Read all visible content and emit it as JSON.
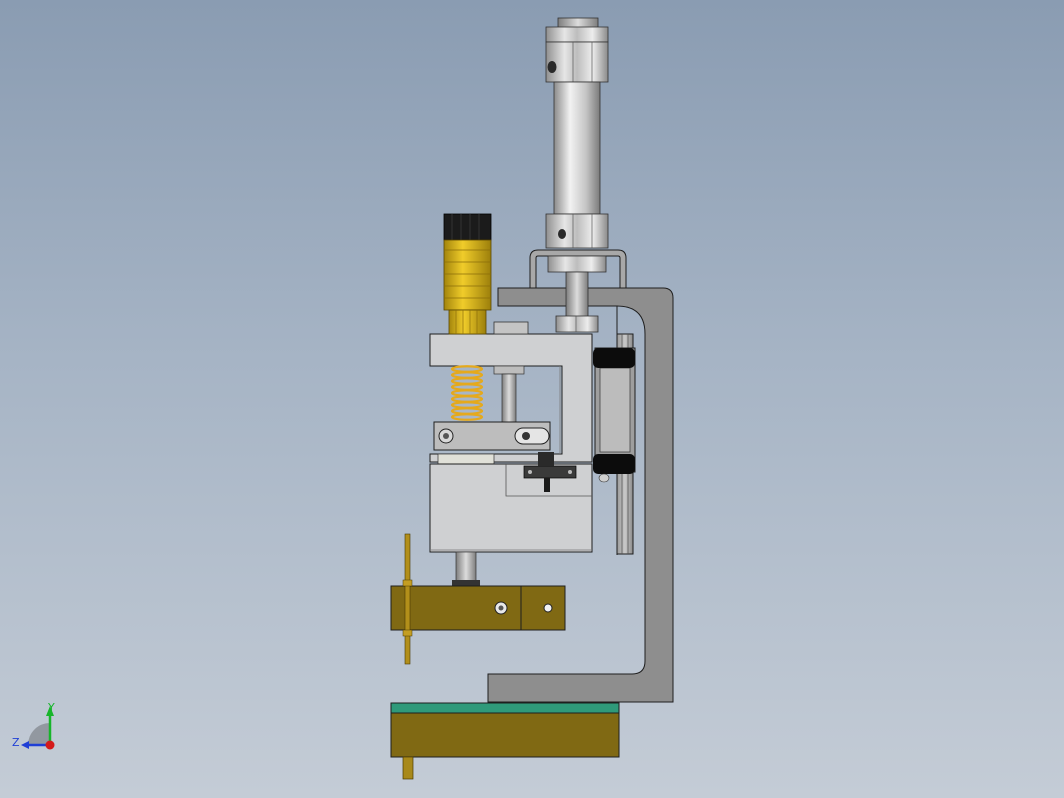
{
  "view": {
    "background_top": "#8a9cb2",
    "background_bottom": "#c4ccd6"
  },
  "model": {
    "colors": {
      "frame": "#8e8e8e",
      "block": "#cfd0d2",
      "gold": "#806913",
      "knob_gold": "#d0ad18",
      "spring": "#e5a91c",
      "rail_black": "#0c0c0c",
      "base_green": "#2f9a7a",
      "outline": "#1e1e1e"
    }
  },
  "triad": {
    "y_label": "Y",
    "z_label": "Z",
    "y_color": "#17b52a",
    "z_color": "#1f3fd6",
    "x_color": "#d41a1a"
  }
}
